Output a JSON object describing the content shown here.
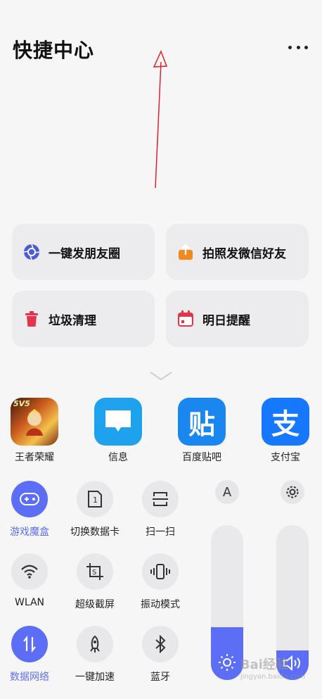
{
  "header": {
    "title": "快捷中心"
  },
  "shortcuts": [
    {
      "label": "一键发朋友圈",
      "icon": "camera-aperture-icon"
    },
    {
      "label": "拍照发微信好友",
      "icon": "upload-icon"
    },
    {
      "label": "垃圾清理",
      "icon": "trash-icon"
    },
    {
      "label": "明日提醒",
      "icon": "calendar-icon"
    }
  ],
  "apps": [
    {
      "label": "王者荣耀",
      "badge": "5V5"
    },
    {
      "label": "信息"
    },
    {
      "label": "百度贴吧",
      "glyph": "贴"
    },
    {
      "label": "支付宝",
      "glyph": "支"
    }
  ],
  "toggles": [
    {
      "label": "游戏魔盒",
      "active": true
    },
    {
      "label": "切换数据卡",
      "glyph": "1",
      "active": false
    },
    {
      "label": "扫一扫",
      "active": false
    },
    {
      "label": "WLAN",
      "active": false
    },
    {
      "label": "超级截屏",
      "glyph": "S",
      "active": false
    },
    {
      "label": "振动模式",
      "active": false
    },
    {
      "label": "数据网络",
      "active": true
    },
    {
      "label": "一键加速",
      "active": false
    },
    {
      "label": "蓝牙",
      "glyph": "✱",
      "active": false
    }
  ],
  "sliders": {
    "auto_brightness_label": "A",
    "brightness_level": 0.34,
    "volume_level": 0.19
  },
  "colors": {
    "accent": "#5b6ef5",
    "background": "#f6f6f7"
  },
  "watermark": {
    "main": "Bai经验",
    "sub": "jingyan.baidu.com"
  }
}
